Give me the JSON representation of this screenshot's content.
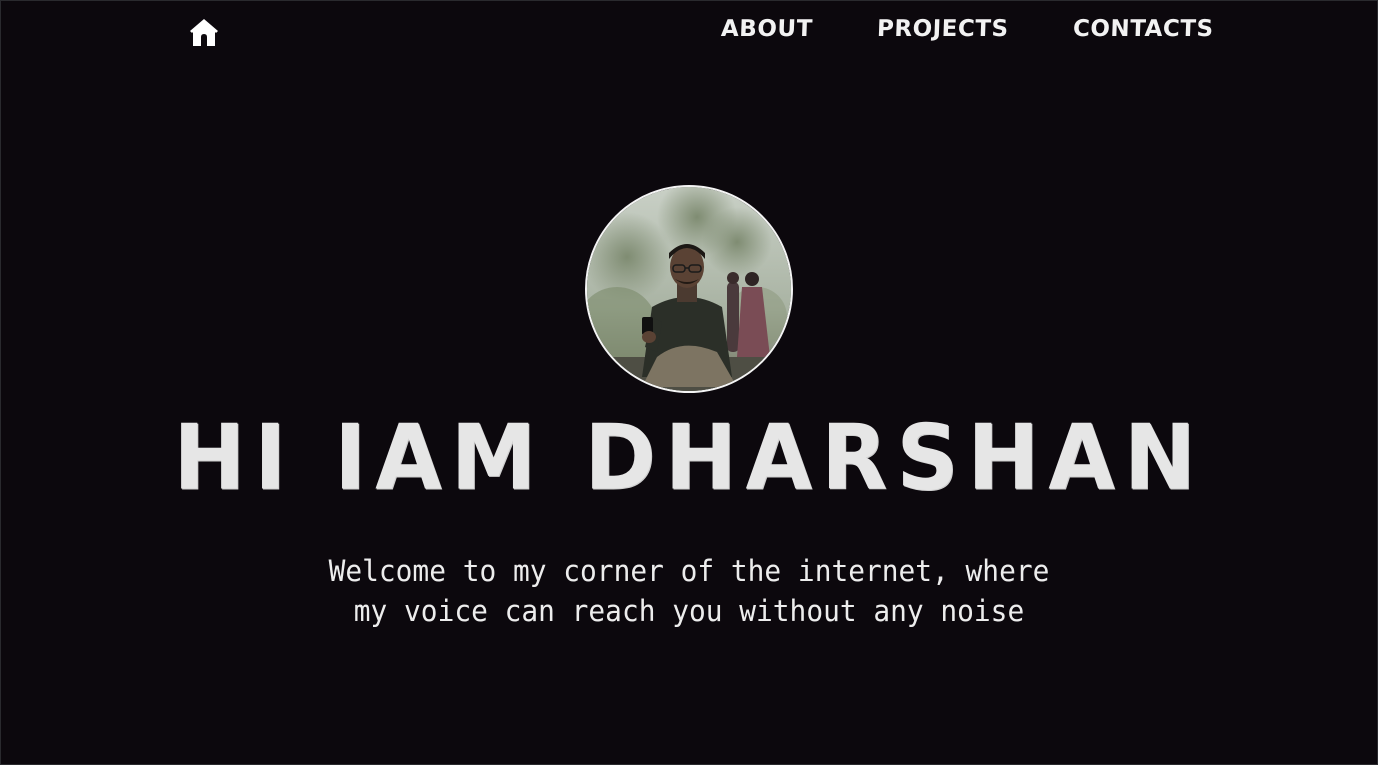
{
  "nav": {
    "home_icon": "home-icon",
    "items": [
      {
        "label": "ABOUT"
      },
      {
        "label": "PROJECTS"
      },
      {
        "label": "CONTACTS"
      }
    ]
  },
  "hero": {
    "title": "HI IAM DHARSHAN",
    "intro": "Welcome to my corner of the internet, where my voice can reach you without any noise",
    "avatar_icon": "profile-photo"
  },
  "colors": {
    "background": "#0c080d",
    "text": "#e6e6e6",
    "avatar_border": "#f4f4f4"
  }
}
